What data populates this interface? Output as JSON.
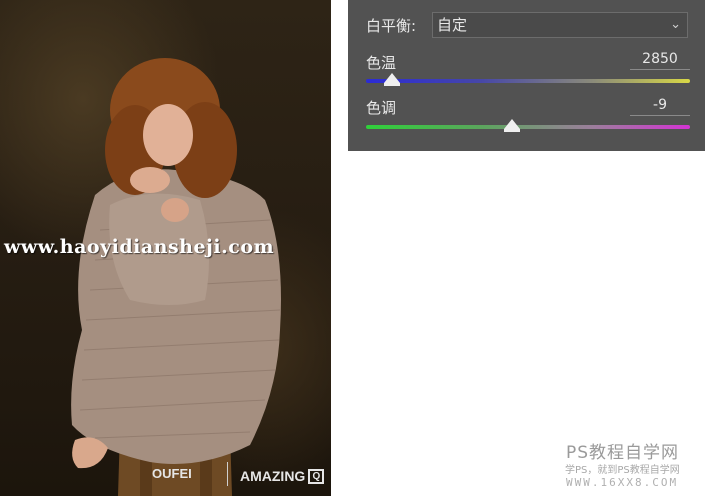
{
  "photo": {
    "watermark": "www.haoyidiansheji.com",
    "logo_left": "OUFEI",
    "logo_right": "AMAZING"
  },
  "panel": {
    "white_balance_label": "白平衡:",
    "white_balance_value": "自定",
    "temperature_label": "色温",
    "temperature_value": "2850",
    "temperature_level": 0.08,
    "tint_label": "色调",
    "tint_value": "-9",
    "tint_level": 0.45,
    "temperature_colors": [
      "#2b2bd6",
      "#d8d846"
    ],
    "tint_colors": [
      "#2fd03a",
      "#d434d4"
    ]
  },
  "site": {
    "title": "PS教程自学网",
    "subtitle": "学PS，就到PS教程自学网",
    "url": "WWW.16XX8.COM"
  }
}
